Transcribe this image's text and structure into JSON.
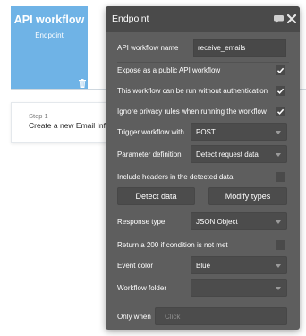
{
  "background": {
    "workflow_card": {
      "title": "API workflow",
      "subtitle": "Endpoint",
      "color": "#6fb3e6"
    },
    "step": {
      "label": "Step 1",
      "text": "Create a new Email Info..."
    }
  },
  "panel": {
    "title": "Endpoint",
    "workflow_name_label": "API workflow name",
    "workflow_name_value": "receive_emails",
    "expose_label": "Expose as a public API workflow",
    "expose_checked": true,
    "no_auth_label": "This workflow can be run without authentication",
    "no_auth_checked": true,
    "ignore_privacy_label": "Ignore privacy rules when running the workflow",
    "ignore_privacy_checked": true,
    "trigger_label": "Trigger workflow with",
    "trigger_value": "POST",
    "param_def_label": "Parameter definition",
    "param_def_value": "Detect request data",
    "include_headers_label": "Include headers in the detected data",
    "include_headers_checked": false,
    "detect_data_button": "Detect data",
    "modify_types_button": "Modify types",
    "response_type_label": "Response type",
    "response_type_value": "JSON Object",
    "return_200_label": "Return a 200 if condition is not met",
    "return_200_checked": false,
    "event_color_label": "Event color",
    "event_color_value": "Blue",
    "folder_label": "Workflow folder",
    "folder_value": "",
    "only_when_label": "Only when",
    "only_when_placeholder": "Click"
  },
  "icons": {
    "comment": "speech-bubble-icon",
    "close": "close-icon",
    "trash": "trash-icon",
    "dropdown": "chevron-down-icon",
    "check": "checkmark-icon"
  },
  "colors": {
    "panel_bg": "#5e5e5e",
    "panel_header": "#4a4a4a",
    "accent_blue": "#6fb3e6"
  }
}
